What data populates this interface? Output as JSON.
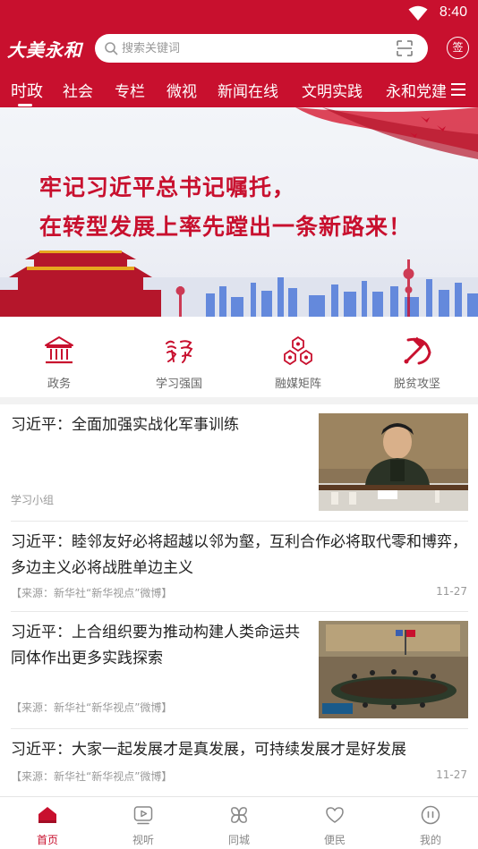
{
  "status_bar": {
    "time": "8:40"
  },
  "header": {
    "logo_text": "大美永和",
    "search_placeholder": "搜索关键词",
    "sign_label": "签"
  },
  "tabs": [
    {
      "label": "时政",
      "active": true
    },
    {
      "label": "社会"
    },
    {
      "label": "专栏"
    },
    {
      "label": "微视"
    },
    {
      "label": "新闻在线"
    },
    {
      "label": "文明实践"
    },
    {
      "label": "永和党建"
    }
  ],
  "banner": {
    "line1": "牢记习近平总书记嘱托，",
    "line2": "在转型发展上率先蹚出一条新路来！"
  },
  "shortcuts": [
    {
      "label": "政务",
      "icon": "government-building-icon"
    },
    {
      "label": "学习强国",
      "icon": "xuexi-calligraphy-icon"
    },
    {
      "label": "融媒矩阵",
      "icon": "media-network-icon"
    },
    {
      "label": "脱贫攻坚",
      "icon": "hammer-sickle-icon"
    }
  ],
  "news": [
    {
      "title": "习近平：全面加强实战化军事训练",
      "source": "学习小组",
      "date": ""
    },
    {
      "title": "习近平：睦邻友好必将超越以邻为壑，互利合作必将取代零和博弈，多边主义必将战胜单边主义",
      "source": "【来源：新华社“新华视点”微博】",
      "date": "11-27"
    },
    {
      "title": "习近平：上合组织要为推动构建人类命运共同体作出更多实践探索",
      "source": "【来源：新华社“新华视点”微博】",
      "date": ""
    },
    {
      "title": "习近平：大家一起发展才是真发展，可持续发展才是好发展",
      "source": "【来源：新华社“新华视点”微博】",
      "date": "11-27"
    }
  ],
  "bottom_nav": [
    {
      "label": "首页",
      "icon": "home-icon",
      "active": true
    },
    {
      "label": "视听",
      "icon": "video-icon"
    },
    {
      "label": "同城",
      "icon": "clover-icon"
    },
    {
      "label": "便民",
      "icon": "heart-icon"
    },
    {
      "label": "我的",
      "icon": "profile-icon"
    }
  ],
  "colors": {
    "brand": "#c8102e",
    "text": "#222222",
    "muted": "#999999"
  }
}
